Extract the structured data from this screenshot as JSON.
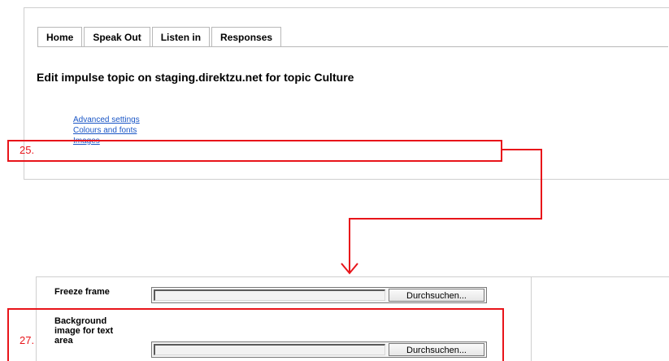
{
  "tabs": [
    {
      "label": "Home"
    },
    {
      "label": "Speak Out"
    },
    {
      "label": "Listen in"
    },
    {
      "label": "Responses"
    }
  ],
  "page_title": "Edit impulse topic on staging.direktzu.net for topic Culture",
  "links": [
    {
      "label": "Advanced settings"
    },
    {
      "label": "Colours and fonts"
    },
    {
      "label": "Images"
    }
  ],
  "annotations": {
    "step_25": "25.",
    "step_27": "27.",
    "highlight_color": "#e8141a"
  },
  "form": {
    "freeze_frame": {
      "label": "Freeze frame",
      "value": "",
      "button_label": "Durchsuchen..."
    },
    "background_image": {
      "label": "Background image for text area",
      "value": "",
      "button_label": "Durchsuchen..."
    }
  },
  "colors": {
    "link": "#1a56c6",
    "annotation": "#e8141a",
    "panel_border": "#cfcfcf"
  }
}
